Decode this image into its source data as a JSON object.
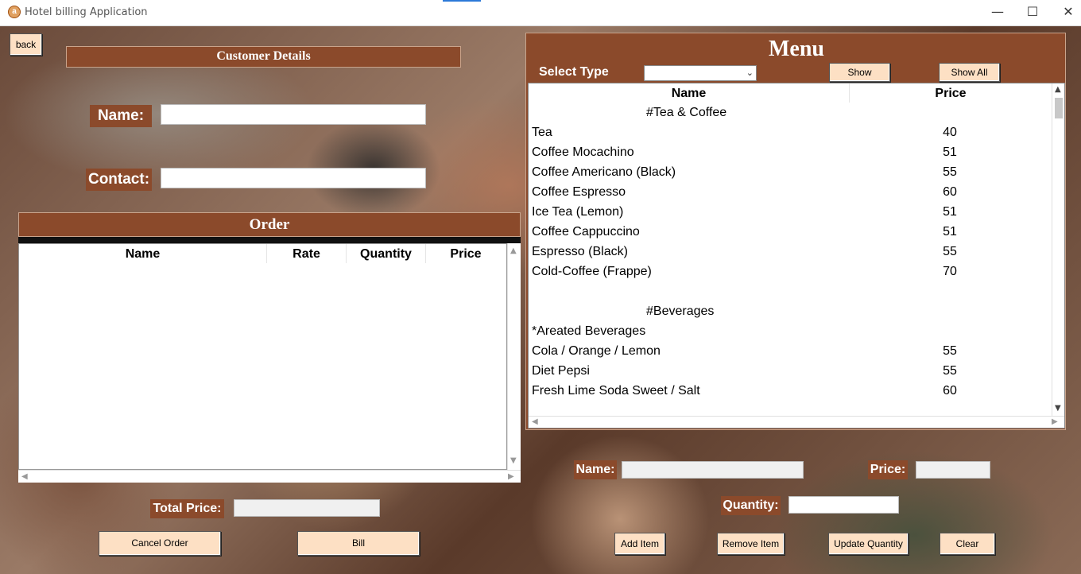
{
  "window": {
    "title": "Hotel billing Application",
    "controls": {
      "minimize": "—",
      "maximize": "☐",
      "close": "✕"
    }
  },
  "back_button": "back",
  "customer": {
    "header": "Customer Details",
    "name_label": "Name:",
    "name_value": "",
    "contact_label": "Contact:",
    "contact_value": ""
  },
  "order": {
    "header": "Order",
    "columns": [
      "Name",
      "Rate",
      "Quantity",
      "Price"
    ],
    "rows": [],
    "total_label": "Total Price:",
    "total_value": "",
    "cancel_button": "Cancel Order",
    "bill_button": "Bill"
  },
  "menu": {
    "title": "Menu",
    "select_type_label": "Select Type",
    "select_type_value": "",
    "show_button": "Show",
    "show_all_button": "Show All",
    "columns": [
      "Name",
      "Price"
    ],
    "rows": [
      {
        "name": "#Tea & Coffee",
        "price": "",
        "kind": "section"
      },
      {
        "name": "Tea",
        "price": "40",
        "kind": "item"
      },
      {
        "name": "Coffee Mocachino",
        "price": "51",
        "kind": "item"
      },
      {
        "name": "Coffee Americano (Black)",
        "price": "55",
        "kind": "item"
      },
      {
        "name": "Coffee Espresso",
        "price": "60",
        "kind": "item"
      },
      {
        "name": "Ice Tea (Lemon)",
        "price": "51",
        "kind": "item"
      },
      {
        "name": "Coffee Cappuccino",
        "price": "51",
        "kind": "item"
      },
      {
        "name": "Espresso (Black)",
        "price": "55",
        "kind": "item"
      },
      {
        "name": "Cold-Coffee (Frappe)",
        "price": "70",
        "kind": "item"
      },
      {
        "name": "",
        "price": "",
        "kind": "blank"
      },
      {
        "name": "#Beverages",
        "price": "",
        "kind": "section"
      },
      {
        "name": "*Areated Beverages",
        "price": "",
        "kind": "sub"
      },
      {
        "name": "Cola / Orange / Lemon",
        "price": "55",
        "kind": "item"
      },
      {
        "name": "Diet Pepsi",
        "price": "55",
        "kind": "item"
      },
      {
        "name": "Fresh Lime Soda Sweet / Salt",
        "price": "60",
        "kind": "item"
      }
    ]
  },
  "item_form": {
    "name_label": "Name:",
    "name_value": "",
    "price_label": "Price:",
    "price_value": "",
    "quantity_label": "Quantity:",
    "quantity_value": "",
    "add_button": "Add Item",
    "remove_button": "Remove Item",
    "update_button": "Update Quantity",
    "clear_button": "Clear"
  },
  "colors": {
    "panel_brown": "#8b4a2b",
    "button_bg": "#fde0c4"
  }
}
